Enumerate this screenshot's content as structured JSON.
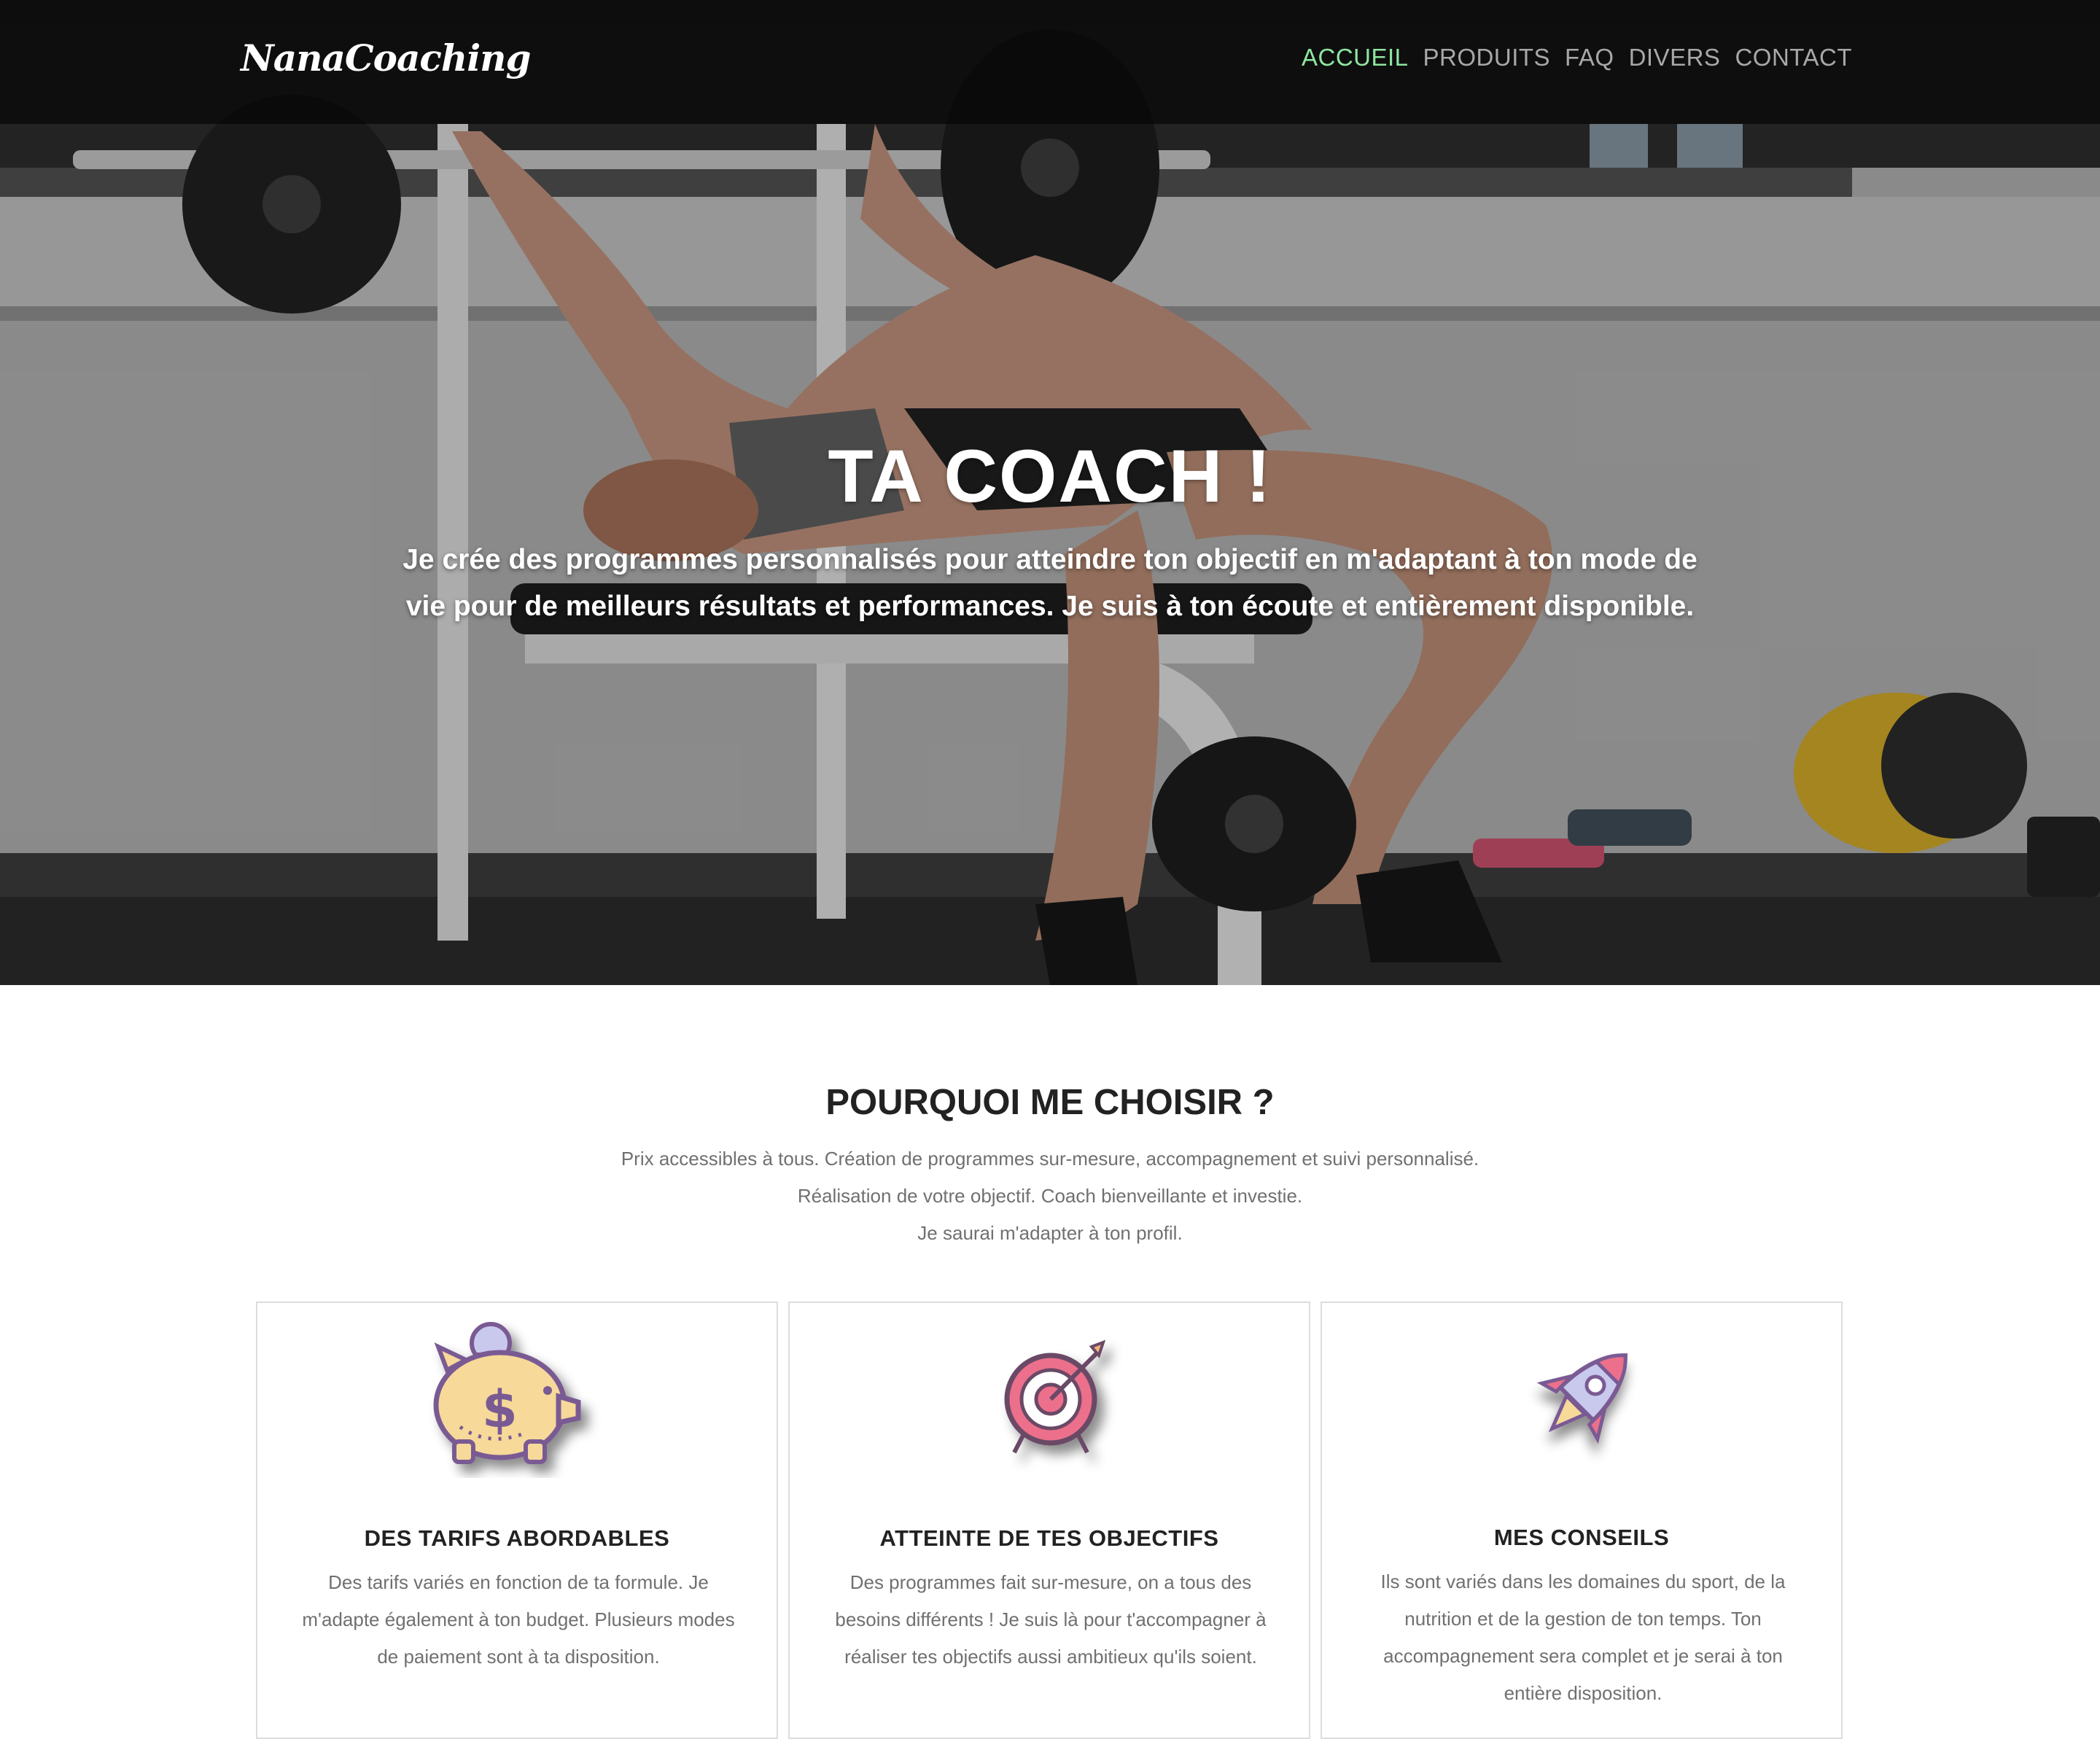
{
  "navbar": {
    "brand": "NanaCoaching",
    "links": [
      {
        "label": "ACCUEIL",
        "active": true
      },
      {
        "label": "PRODUITS",
        "active": false
      },
      {
        "label": "FAQ",
        "active": false
      },
      {
        "label": "DIVERS",
        "active": false
      },
      {
        "label": "CONTACT",
        "active": false
      }
    ],
    "active_color": "#8ee6a0"
  },
  "hero": {
    "title": "TA COACH !",
    "subtitle": "Je crée des programmes personnalisés pour atteindre ton objectif en m'adaptant à ton mode de vie pour de meilleurs résultats et performances. Je suis à ton écoute et entièrement disponible."
  },
  "section": {
    "title": "POURQUOI ME CHOISIR ?",
    "lines": [
      "Prix accessibles à tous. Création de programmes sur-mesure, accompagnement et suivi personnalisé.",
      "Réalisation de votre objectif. Coach bienveillante et investie.",
      "Je saurai m'adapter à ton profil."
    ]
  },
  "cards": [
    {
      "icon": "piggy-bank-icon",
      "title": "DES TARIFS ABORDABLES",
      "text": "Des tarifs variés en fonction de ta formule. Je m'adapte également à ton budget. Plusieurs modes de paiement sont à ta disposition."
    },
    {
      "icon": "target-icon",
      "title": "ATTEINTE DE TES OBJECTIFS",
      "text": "Des programmes fait sur-mesure, on a tous des besoins différents ! Je suis là pour t'accompagner à réaliser tes objectifs aussi ambitieux qu'ils soient."
    },
    {
      "icon": "rocket-icon",
      "title": "MES CONSEILS",
      "text": "Ils sont variés dans les domaines du sport, de la nutrition et de la gestion de ton temps. Ton accompagnement sera complet et je serai à ton entière disposition."
    }
  ]
}
